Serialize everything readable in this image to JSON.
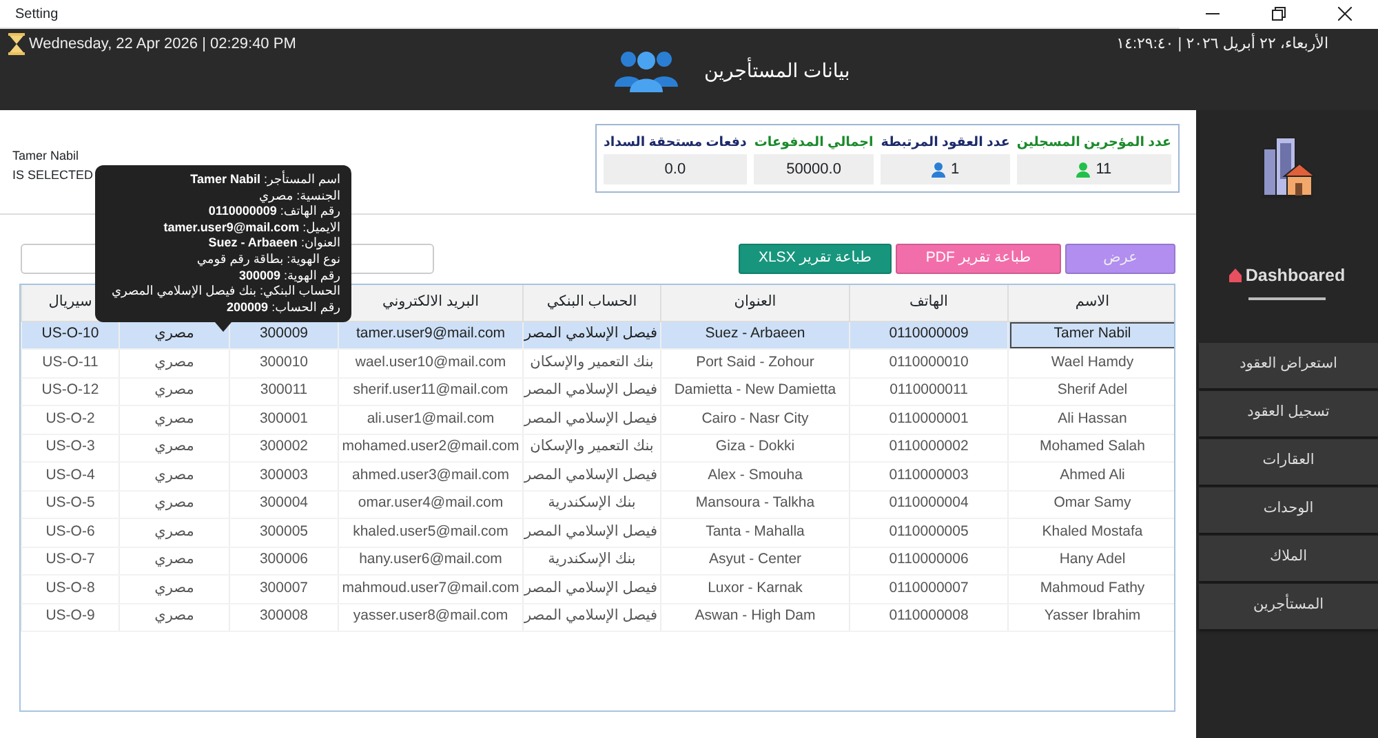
{
  "window": {
    "title": "Setting"
  },
  "header": {
    "date_en": "Wednesday, 22 Apr 2026  |  02:29:40 PM",
    "title": "بيانات المستأجرين",
    "date_ar": "الأربعاء، ٢٢ أبريل ٢٠٢٦ | ١٤:٢٩:٤٠"
  },
  "selection": {
    "name": "Tamer Nabil",
    "status": "IS SELECTED"
  },
  "stats": [
    {
      "label": "عدد المؤجرين المسجلين",
      "value": "11",
      "color": "#1a8a2a",
      "icon": {
        "color": "#22c04a"
      }
    },
    {
      "label": "عدد العقود المرتبطة",
      "value": "1",
      "color": "#1c2a6b",
      "icon": {
        "color": "#2a7fd4"
      }
    },
    {
      "label": "اجمالي المدفوعات",
      "value": "50000.0",
      "color": "#1a8a2a"
    },
    {
      "label": "دفعات مستحقة السداد",
      "value": "0.0",
      "color": "#1c2a6b"
    }
  ],
  "buttons": [
    {
      "label": "عرض",
      "kind": "view"
    },
    {
      "label": "طباعة تقرير PDF",
      "kind": "pdf"
    },
    {
      "label": "طباعة تقرير XLSX",
      "kind": "xlsx"
    }
  ],
  "table": {
    "columns": [
      {
        "label": "الاسم"
      },
      {
        "label": "الهاتف"
      },
      {
        "label": "العنوان"
      },
      {
        "label": "الحساب البنكي"
      },
      {
        "label": "البريد الالكتروني"
      },
      {},
      {},
      {
        "label": "سيريال"
      }
    ],
    "rows": [
      {
        "selected": true,
        "cells": [
          "Tamer Nabil",
          "0110000009",
          "Suez - Arbaeen",
          "فيصل الإسلامي المصر",
          "tamer.user9@mail.com",
          "300009",
          "مصري",
          "US-O-10"
        ]
      },
      {
        "selected": false,
        "cells": [
          "Wael Hamdy",
          "0110000010",
          "Port Said - Zohour",
          "بنك التعمير والإسكان",
          "wael.user10@mail.com",
          "300010",
          "مصري",
          "US-O-11"
        ]
      },
      {
        "selected": false,
        "cells": [
          "Sherif Adel",
          "0110000011",
          "Damietta - New Damietta",
          "فيصل الإسلامي المصر",
          "sherif.user11@mail.com",
          "300011",
          "مصري",
          "US-O-12"
        ]
      },
      {
        "selected": false,
        "cells": [
          "Ali Hassan",
          "0110000001",
          "Cairo - Nasr City",
          "فيصل الإسلامي المصر",
          "ali.user1@mail.com",
          "300001",
          "مصري",
          "US-O-2"
        ]
      },
      {
        "selected": false,
        "cells": [
          "Mohamed Salah",
          "0110000002",
          "Giza - Dokki",
          "بنك التعمير والإسكان",
          "mohamed.user2@mail.com",
          "300002",
          "مصري",
          "US-O-3"
        ]
      },
      {
        "selected": false,
        "cells": [
          "Ahmed Ali",
          "0110000003",
          "Alex - Smouha",
          "فيصل الإسلامي المصر",
          "ahmed.user3@mail.com",
          "300003",
          "مصري",
          "US-O-4"
        ]
      },
      {
        "selected": false,
        "cells": [
          "Omar Samy",
          "0110000004",
          "Mansoura - Talkha",
          "بنك الإسكندرية",
          "omar.user4@mail.com",
          "300004",
          "مصري",
          "US-O-5"
        ]
      },
      {
        "selected": false,
        "cells": [
          "Khaled Mostafa",
          "0110000005",
          "Tanta - Mahalla",
          "فيصل الإسلامي المصر",
          "khaled.user5@mail.com",
          "300005",
          "مصري",
          "US-O-6"
        ]
      },
      {
        "selected": false,
        "cells": [
          "Hany Adel",
          "0110000006",
          "Asyut - Center",
          "بنك الإسكندرية",
          "hany.user6@mail.com",
          "300006",
          "مصري",
          "US-O-7"
        ]
      },
      {
        "selected": false,
        "cells": [
          "Mahmoud Fathy",
          "0110000007",
          "Luxor - Karnak",
          "فيصل الإسلامي المصر",
          "mahmoud.user7@mail.com",
          "300007",
          "مصري",
          "US-O-8"
        ]
      },
      {
        "selected": false,
        "cells": [
          "Yasser Ibrahim",
          "0110000008",
          "Aswan - High Dam",
          "فيصل الإسلامي المصر",
          "yasser.user8@mail.com",
          "300008",
          "مصري",
          "US-O-9"
        ]
      }
    ]
  },
  "tooltip": {
    "lines": [
      "اسم المستأجر: **Tamer Nabil**",
      "الجنسية: مصري",
      "رقم الهاتف: **0110000009**",
      "الايميل: **tamer.user9@mail.com**",
      "العنوان: **Suez - Arbaeen**",
      "نوع الهوية: بطاقة رقم قومي",
      "رقم الهوية: **300009**",
      "الحساب البنكي: بنك فيصل الإسلامي المصري",
      "رقم الحساب: **200009**"
    ]
  },
  "sidebar": {
    "title": "Dashboared",
    "items": [
      {
        "label": "استعراض العقود"
      },
      {
        "label": "تسجيل العقود"
      },
      {
        "label": "العقارات"
      },
      {
        "label": "الوحدات"
      },
      {
        "label": "الملاك"
      },
      {
        "label": "المستأجرين"
      }
    ]
  }
}
